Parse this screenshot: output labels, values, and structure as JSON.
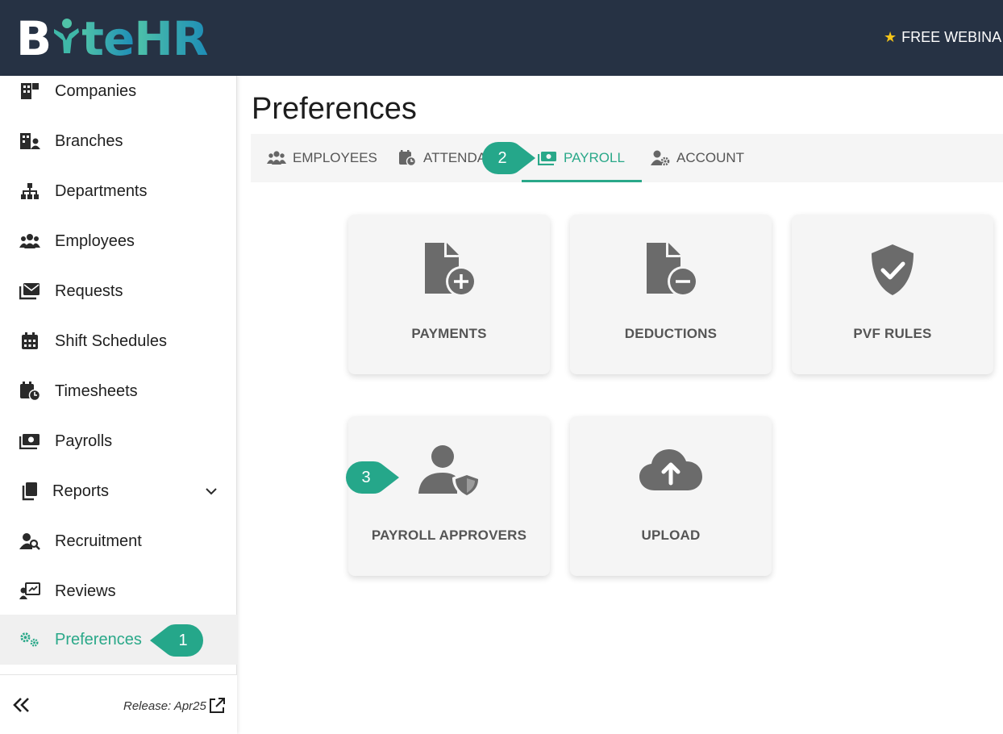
{
  "header": {
    "logo_text_a": "B",
    "logo_text_b": "te",
    "logo_text_c": "HR",
    "promo": "FREE WEBINA"
  },
  "sidebar": {
    "items": [
      {
        "label": "Companies"
      },
      {
        "label": "Branches"
      },
      {
        "label": "Departments"
      },
      {
        "label": "Employees"
      },
      {
        "label": "Requests"
      },
      {
        "label": "Shift Schedules"
      },
      {
        "label": "Timesheets"
      },
      {
        "label": "Payrolls"
      },
      {
        "label": "Reports"
      },
      {
        "label": "Recruitment"
      },
      {
        "label": "Reviews"
      },
      {
        "label": "Preferences"
      }
    ],
    "release": "Release: Apr25"
  },
  "main": {
    "title": "Preferences",
    "tabs": [
      {
        "label": "EMPLOYEES"
      },
      {
        "label": "ATTENDAN"
      },
      {
        "label": "PAYROLL"
      },
      {
        "label": "ACCOUNT"
      }
    ],
    "cards": [
      {
        "label": "PAYMENTS"
      },
      {
        "label": "DEDUCTIONS"
      },
      {
        "label": "PVF RULES"
      },
      {
        "label": "PAYROLL APPROVERS"
      },
      {
        "label": "UPLOAD"
      }
    ]
  },
  "callouts": [
    "1",
    "2",
    "3"
  ],
  "colors": {
    "header_bg": "#263244",
    "accent": "#2aa889",
    "callout": "#25a78a",
    "icon_gray": "#6b6b6b",
    "card_bg": "#f5f5f5"
  }
}
